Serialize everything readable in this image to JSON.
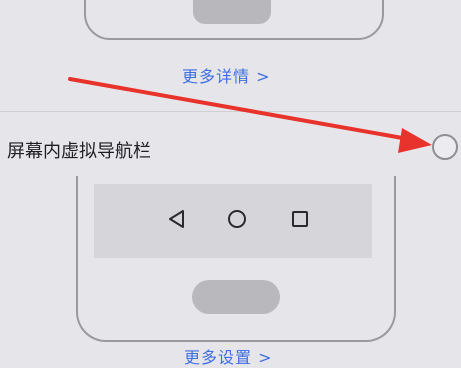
{
  "top_section": {
    "more_details_label": "更多详情 >"
  },
  "option": {
    "label": "屏幕内虚拟导航栏",
    "selected": false
  },
  "bottom_section": {
    "more_settings_label": "更多设置 >",
    "nav_keys": [
      "back-icon",
      "home-icon",
      "recent-apps-icon"
    ]
  },
  "colors": {
    "link": "#3f6ee0",
    "annotation_arrow": "#e8332c",
    "background": "#e6e6ea"
  }
}
